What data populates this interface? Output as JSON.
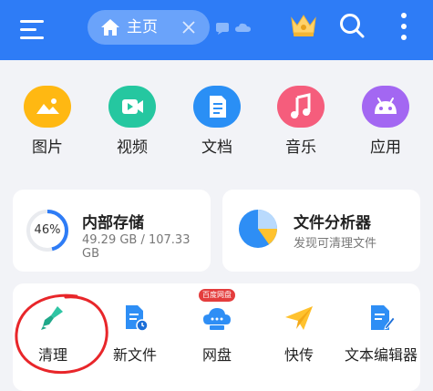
{
  "topbar": {
    "tab": {
      "label": "主页"
    }
  },
  "categories": [
    {
      "label": "图片",
      "icon": "image-icon",
      "color": "#ffb812"
    },
    {
      "label": "视频",
      "icon": "video-icon",
      "color": "#25c7a0"
    },
    {
      "label": "文档",
      "icon": "document-icon",
      "color": "#2a8ff5"
    },
    {
      "label": "音乐",
      "icon": "music-icon",
      "color": "#f55d7c"
    },
    {
      "label": "应用",
      "icon": "android-icon",
      "color": "#a367f2"
    }
  ],
  "storage": {
    "title": "内部存储",
    "usage": "49.29 GB / 107.33 GB",
    "percent_label": "46%",
    "percent": 46
  },
  "analyzer": {
    "title": "文件分析器",
    "subtitle": "发现可清理文件"
  },
  "tools": [
    {
      "label": "清理",
      "icon": "broom-icon"
    },
    {
      "label": "新文件",
      "icon": "new-file-icon"
    },
    {
      "label": "网盘",
      "icon": "cloud-disk-icon",
      "badge": "百度网盘"
    },
    {
      "label": "快传",
      "icon": "paper-plane-icon"
    },
    {
      "label": "文本编辑器",
      "icon": "text-editor-icon"
    }
  ]
}
